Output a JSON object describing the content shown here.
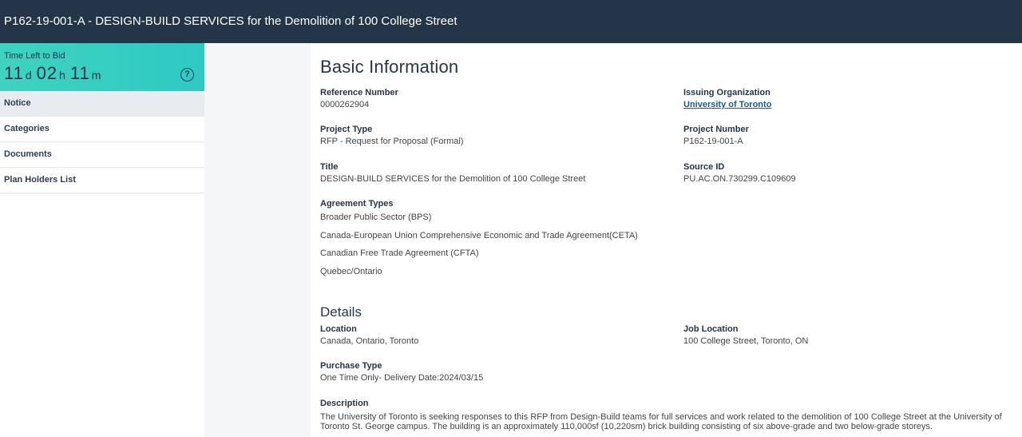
{
  "header": {
    "title": "P162-19-001-A - DESIGN-BUILD SERVICES for the Demolition of 100 College Street"
  },
  "timer": {
    "label": "Time Left to Bid",
    "days": "11",
    "days_unit": "d",
    "hours": "02",
    "hours_unit": "h",
    "minutes": "11",
    "minutes_unit": "m",
    "help_glyph": "?"
  },
  "nav": {
    "items": [
      {
        "label": "Notice"
      },
      {
        "label": "Categories"
      },
      {
        "label": "Documents"
      },
      {
        "label": "Plan Holders List"
      }
    ]
  },
  "basic": {
    "heading": "Basic Information",
    "reference_number": {
      "label": "Reference Number",
      "value": "0000262904"
    },
    "issuing_org": {
      "label": "Issuing Organization",
      "value": "University of Toronto"
    },
    "project_type": {
      "label": "Project Type",
      "value": "RFP - Request for Proposal (Formal)"
    },
    "project_number": {
      "label": "Project Number",
      "value": "P162-19-001-A"
    },
    "title": {
      "label": "Title",
      "value": "DESIGN-BUILD SERVICES for the Demolition of 100 College Street"
    },
    "source_id": {
      "label": "Source ID",
      "value": "PU.AC.ON.730299.C109609"
    },
    "agreement_types": {
      "label": "Agreement Types",
      "items": [
        "Broader Public Sector (BPS)",
        "Canada-European Union Comprehensive Economic and Trade Agreement(CETA)",
        "Canadian Free Trade Agreement (CFTA)",
        "Quebec/Ontario"
      ]
    }
  },
  "details": {
    "heading": "Details",
    "location": {
      "label": "Location",
      "value": "Canada, Ontario, Toronto"
    },
    "job_location": {
      "label": "Job Location",
      "value": "100 College Street, Toronto, ON"
    },
    "purchase_type": {
      "label": "Purchase Type",
      "value": "One Time Only- Delivery Date:2024/03/15"
    },
    "description": {
      "label": "Description",
      "value": "The University of Toronto is seeking responses to this RFP from Design-Build teams for full services and work related to the demolition of 100 College Street at the University of Toronto St. George campus. The building is an approximately 110,000sf (10,220sm) brick building consisting of six above-grade and two below-grade storeys."
    }
  },
  "colors": {
    "header_bg": "#253548",
    "timer_bg": "#3ed3c0",
    "link": "#1a5a9a"
  }
}
